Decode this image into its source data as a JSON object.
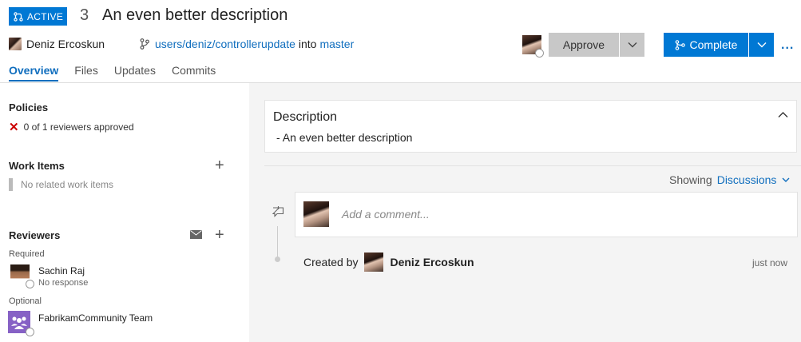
{
  "pr": {
    "status": "ACTIVE",
    "id": "3",
    "title": "An even better description",
    "author": "Deniz Ercoskun",
    "source_branch": "users/deniz/controllerupdate",
    "into_label": "into",
    "target_branch": "master"
  },
  "actions": {
    "approve_label": "Approve",
    "complete_label": "Complete",
    "more_label": "..."
  },
  "tabs": [
    {
      "label": "Overview",
      "active": true
    },
    {
      "label": "Files",
      "active": false
    },
    {
      "label": "Updates",
      "active": false
    },
    {
      "label": "Commits",
      "active": false
    }
  ],
  "sidebar": {
    "policies": {
      "title": "Policies",
      "items": [
        {
          "status": "failed",
          "text": "0 of 1 reviewers approved"
        }
      ]
    },
    "work_items": {
      "title": "Work Items",
      "empty_text": "No related work items"
    },
    "reviewers": {
      "title": "Reviewers",
      "required_label": "Required",
      "optional_label": "Optional",
      "required": [
        {
          "name": "Sachin Raj",
          "status": "No response"
        }
      ],
      "optional": [
        {
          "name": "FabrikamCommunity Team",
          "status": ""
        }
      ]
    }
  },
  "main": {
    "description": {
      "title": "Description",
      "body": "- An even better description"
    },
    "filter": {
      "showing_label": "Showing",
      "value": "Discussions"
    },
    "comment": {
      "placeholder": "Add a comment..."
    },
    "timeline": {
      "created_by_label": "Created by",
      "created_by_name": "Deniz Ercoskun",
      "time": "just now"
    }
  },
  "colors": {
    "accent": "#0078d4",
    "link": "#106ebe",
    "error": "#cc0000"
  }
}
